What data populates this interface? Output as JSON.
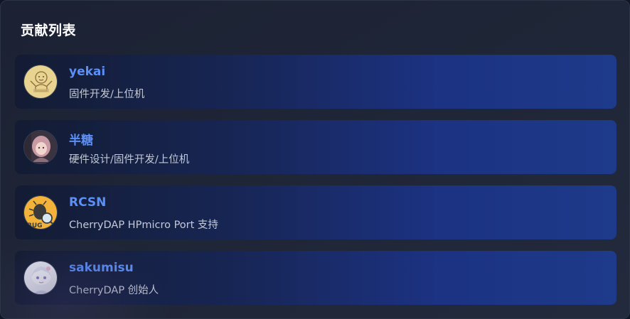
{
  "panel": {
    "title": "贡献列表"
  },
  "contributors": [
    {
      "name": "yekai",
      "role": "固件开发/上位机",
      "avatar_icon": "cartoon-figure-avatar",
      "avatar_color": "#e8d490"
    },
    {
      "name": "半糖",
      "role": "硬件设计/固件开发/上位机",
      "avatar_icon": "anime-girl-avatar",
      "avatar_color": "#b08a8f"
    },
    {
      "name": "RCSN",
      "role": "CherryDAP HPmicro Port 支持",
      "avatar_icon": "bug-magnifier-avatar",
      "avatar_color": "#f3b23a"
    },
    {
      "name": "sakumisu",
      "role": "CherryDAP 创始人",
      "avatar_icon": "anime-character-avatar",
      "avatar_color": "#e6e8f3"
    }
  ],
  "colors": {
    "name_accent": "#5b8ff9",
    "card_gradient_end": "#1e3a8a"
  }
}
